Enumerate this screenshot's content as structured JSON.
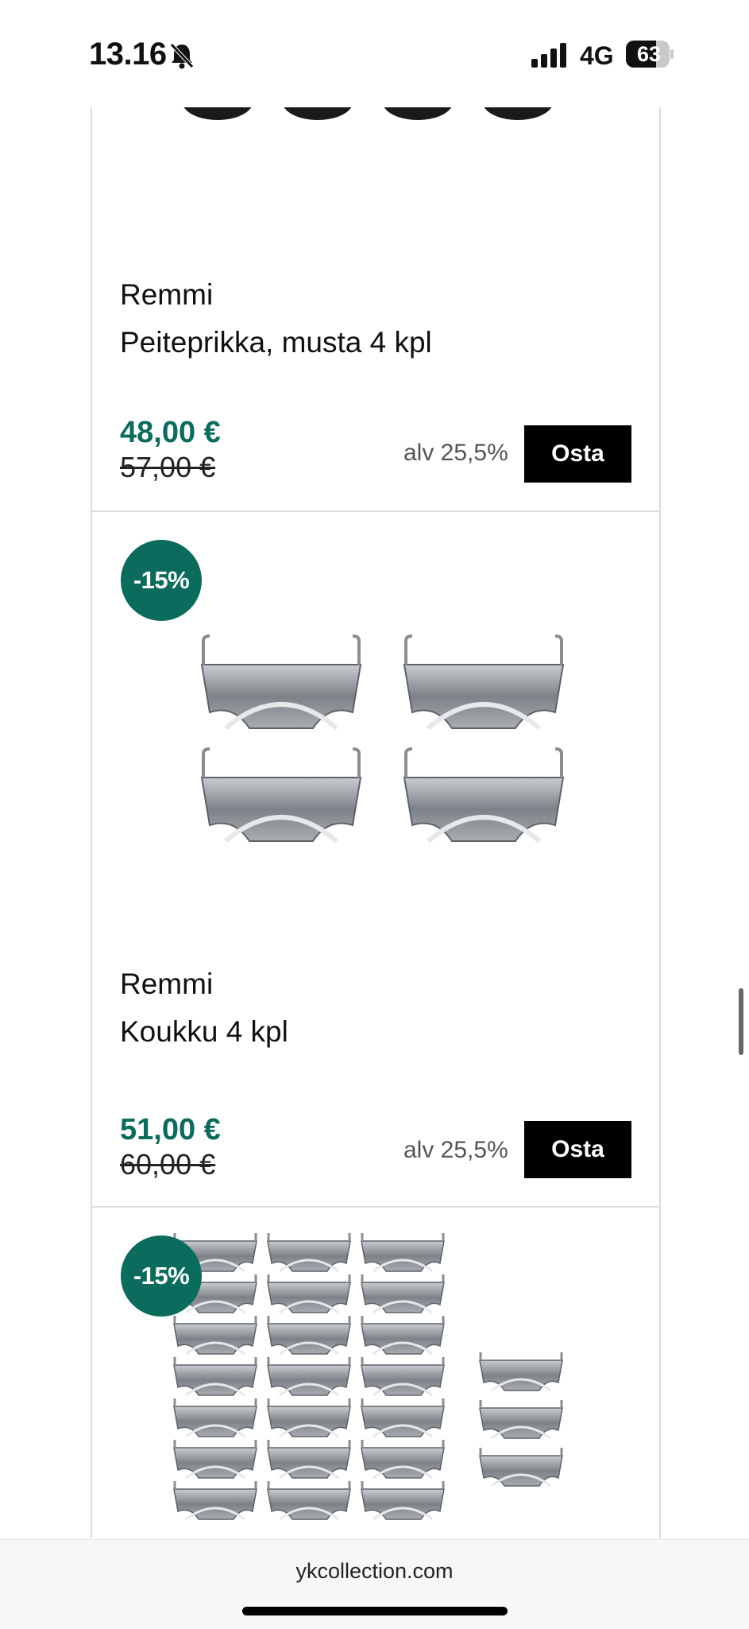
{
  "status_bar": {
    "time": "13.16",
    "network": "4G",
    "battery": "63",
    "icons": [
      "bell-muted-icon",
      "cellular-signal-icon",
      "battery-icon"
    ]
  },
  "colors": {
    "accent": "#0b6b5c",
    "button_bg": "#000000",
    "divider": "#dcdcdc"
  },
  "products": [
    {
      "brand": "Remmi",
      "name": "Peiteprikka, musta 4 kpl",
      "price": "48,00 €",
      "old_price": "57,00 €",
      "vat": "alv 25,5%",
      "buy_label": "Osta"
    },
    {
      "badge": "-15%",
      "brand": "Remmi",
      "name": "Koukku 4 kpl",
      "price": "51,00 €",
      "old_price": "60,00 €",
      "vat": "alv 25,5%",
      "buy_label": "Osta"
    },
    {
      "badge": "-15%"
    }
  ],
  "browser": {
    "url": "ykcollection.com"
  }
}
